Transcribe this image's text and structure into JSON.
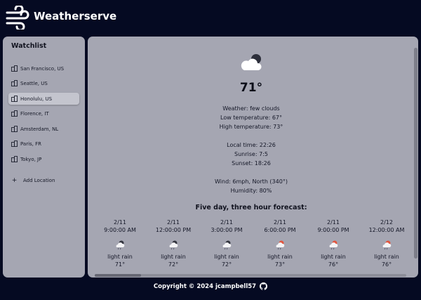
{
  "app": {
    "title": "Weatherserve"
  },
  "sidebar": {
    "title": "Watchlist",
    "items": [
      {
        "label": "San Francisco, US"
      },
      {
        "label": "Seattle, US"
      },
      {
        "label": "Honolulu, US"
      },
      {
        "label": "Florence, IT"
      },
      {
        "label": "Amsterdam, NL"
      },
      {
        "label": "Paris, FR"
      },
      {
        "label": "Tokyo, JP"
      }
    ],
    "active_item": "Honolulu, US",
    "add_label": "Add Location"
  },
  "current": {
    "icon": "few-clouds-night-icon",
    "temperature": "71°",
    "weather": "Weather: few clouds",
    "low": "Low temperature: 67°",
    "high": "High temperature: 73°",
    "local_time": "Local time: 22:26",
    "sunrise": "Sunrise: 7:5",
    "sunset": "Sunset: 18:26",
    "wind": "Wind: 6mph, North (340°)",
    "humidity": "Humidity: 80%"
  },
  "forecast": {
    "title": "Five day, three hour forecast:",
    "items": [
      {
        "date": "2/11",
        "time": "9:00:00 AM",
        "icon": "light-rain-day-icon",
        "desc": "light rain",
        "temp": "71°"
      },
      {
        "date": "2/11",
        "time": "12:00:00 PM",
        "icon": "light-rain-day-icon",
        "desc": "light rain",
        "temp": "72°"
      },
      {
        "date": "2/11",
        "time": "3:00:00 PM",
        "icon": "light-rain-day-icon",
        "desc": "light rain",
        "temp": "72°"
      },
      {
        "date": "2/11",
        "time": "6:00:00 PM",
        "icon": "light-rain-sun-icon",
        "desc": "light rain",
        "temp": "73°"
      },
      {
        "date": "2/11",
        "time": "9:00:00 PM",
        "icon": "light-rain-sun-icon",
        "desc": "light rain",
        "temp": "76°"
      },
      {
        "date": "2/12",
        "time": "12:00:00 AM",
        "icon": "light-rain-sun-icon",
        "desc": "light rain",
        "temp": "76°"
      }
    ]
  },
  "footer": {
    "text": "Copyright © 2024 jcampbell57",
    "icon": "github-icon"
  },
  "colors": {
    "background": "#050a22",
    "panel": "#a5a6b2",
    "active": "#c4c5ce",
    "text": "#141727"
  }
}
